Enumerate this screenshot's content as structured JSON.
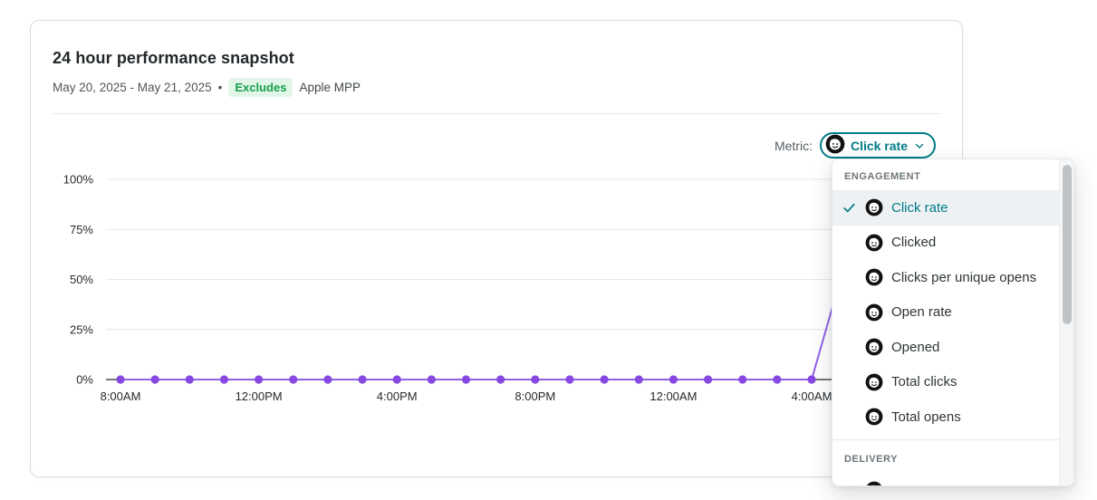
{
  "card": {
    "title": "24 hour performance snapshot",
    "date_range": "May 20, 2025 - May 21, 2025",
    "separator": "•",
    "excludes_badge": "Excludes",
    "excludes_target": "Apple MPP"
  },
  "metric_selector": {
    "label": "Metric:",
    "selected": "Click rate"
  },
  "menu": {
    "sections": [
      {
        "header": "ENGAGEMENT",
        "items": [
          {
            "label": "Click rate",
            "selected": true
          },
          {
            "label": "Clicked"
          },
          {
            "label": "Clicks per unique opens"
          },
          {
            "label": "Open rate"
          },
          {
            "label": "Opened"
          },
          {
            "label": "Total clicks"
          },
          {
            "label": "Total opens"
          }
        ]
      },
      {
        "header": "DELIVERY",
        "items": [
          {
            "label": "",
            "partial": true
          }
        ]
      }
    ]
  },
  "colors": {
    "teal": "#007c89",
    "line_purple": "#9360e8",
    "dot_purple": "#8748e2",
    "grid_light": "#e7e8e9",
    "axis_dark": "#25282a",
    "axis_text": "#26292c",
    "badge_green_bg": "#e1f6e8",
    "badge_green_text": "#17a04b",
    "selected_row_bg": "#edf1f4"
  },
  "chart_data": {
    "type": "line",
    "title": "24 hour performance snapshot",
    "metric": "Click rate",
    "unit": "%",
    "ylim": [
      0,
      100
    ],
    "y_ticks": [
      "0%",
      "25%",
      "50%",
      "75%",
      "100%"
    ],
    "x_tick_labels": [
      "8:00AM",
      "12:00PM",
      "4:00PM",
      "8:00PM",
      "12:00AM",
      "4:00AM"
    ],
    "x_tick_every": 4,
    "hours": [
      "8:00AM",
      "9:00AM",
      "10:00AM",
      "11:00AM",
      "12:00PM",
      "1:00PM",
      "2:00PM",
      "3:00PM",
      "4:00PM",
      "5:00PM",
      "6:00PM",
      "7:00PM",
      "8:00PM",
      "9:00PM",
      "10:00PM",
      "11:00PM",
      "12:00AM",
      "1:00AM",
      "2:00AM",
      "3:00AM",
      "4:00AM"
    ],
    "values": [
      0,
      0,
      0,
      0,
      0,
      0,
      0,
      0,
      0,
      0,
      0,
      0,
      0,
      0,
      0,
      0,
      0,
      0,
      0,
      0,
      0
    ],
    "trailing_segment": {
      "estimated_next_value": 60,
      "clipped_by_dropdown": true
    },
    "grid": true,
    "legend": "none"
  }
}
